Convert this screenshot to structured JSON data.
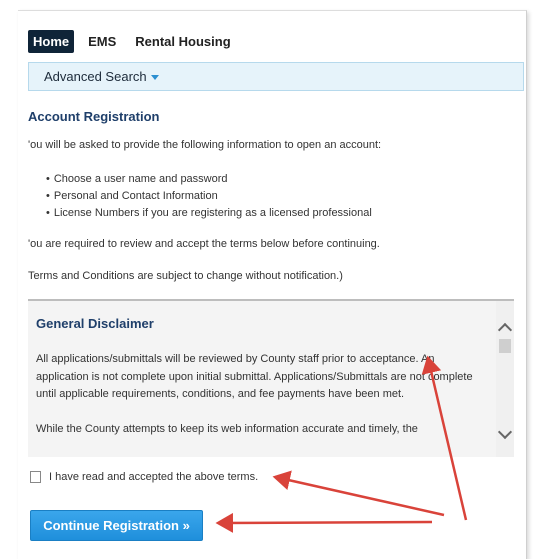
{
  "nav": {
    "tabs": [
      {
        "label": "Home",
        "active": true
      },
      {
        "label": "EMS",
        "active": false
      },
      {
        "label": "Rental Housing",
        "active": false
      }
    ],
    "advanced_search": "Advanced Search"
  },
  "registration": {
    "heading": "Account Registration",
    "intro": "'ou will be asked to provide the following information to open an account:",
    "bullets": [
      "Choose a user name and password",
      "Personal and Contact Information",
      "License Numbers if you are registering as a licensed professional"
    ],
    "review_text": "'ou are required to review and accept the terms below before continuing.",
    "terms_note": "Terms and Conditions are subject to change without notification.)"
  },
  "disclaimer": {
    "title": "General Disclaimer",
    "paragraph1": "All applications/submittals will be reviewed by County staff prior to acceptance. An application is not complete upon initial submittal. Applications/Submittals are not complete until applicable requirements, conditions, and fee payments have been met.",
    "paragraph2": "While the County attempts to keep its web information accurate and timely, the"
  },
  "accept": {
    "label": "I have read and accepted the above terms.",
    "checked": false
  },
  "continue_button": "Continue Registration »",
  "colors": {
    "active_tab": "#0f2438",
    "subnav_bg": "#e6f3fa",
    "heading": "#1f3f6a",
    "button": "#2196e0",
    "annotation_arrow": "#d9433a"
  }
}
